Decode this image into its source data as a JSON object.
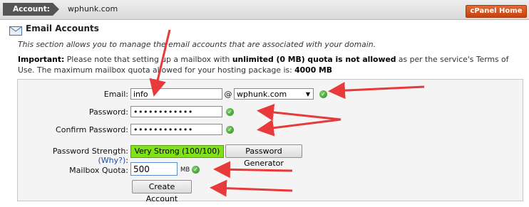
{
  "topbar": {
    "account_label": "Account:",
    "account_domain": "wphunk.com",
    "cpanel_home": "cPanel Home"
  },
  "page": {
    "title": "Email Accounts",
    "intro": "This section allows you to manage the email accounts that are associated with your domain.",
    "notice_important": "Important:",
    "notice_part1": " Please note that setting up a mailbox with ",
    "notice_bold1": "unlimited (0 MB) quota is not allowed",
    "notice_part2": " as per the service's Terms of Use. The maximum mailbox quota allowed for your hosting package is: ",
    "notice_bold2": "4000 MB"
  },
  "form": {
    "email_label": "Email:",
    "email_value": "info",
    "at_sign": "@",
    "domain_selected": "wphunk.com",
    "password_label": "Password:",
    "password_value": "••••••••••••",
    "confirm_label": "Confirm Password:",
    "confirm_value": "••••••••••••",
    "strength_label": "Password Strength:",
    "strength_why": "(Why?)",
    "strength_colon": ":",
    "strength_value": "Very Strong (100/100)",
    "generator_button": "Password Generator",
    "quota_label": "Mailbox Quota:",
    "quota_value": "500",
    "quota_unit": "MB",
    "create_button": "Create Account"
  },
  "colors": {
    "arrow": "#e83a3a",
    "strength_bg": "#80e01a",
    "cpanel_button": "#d5531c",
    "check": "#2e8b1f"
  },
  "icons": {
    "check": "check-circle-icon",
    "mail": "mail-icon",
    "dropdown": "chevron-down-icon"
  }
}
